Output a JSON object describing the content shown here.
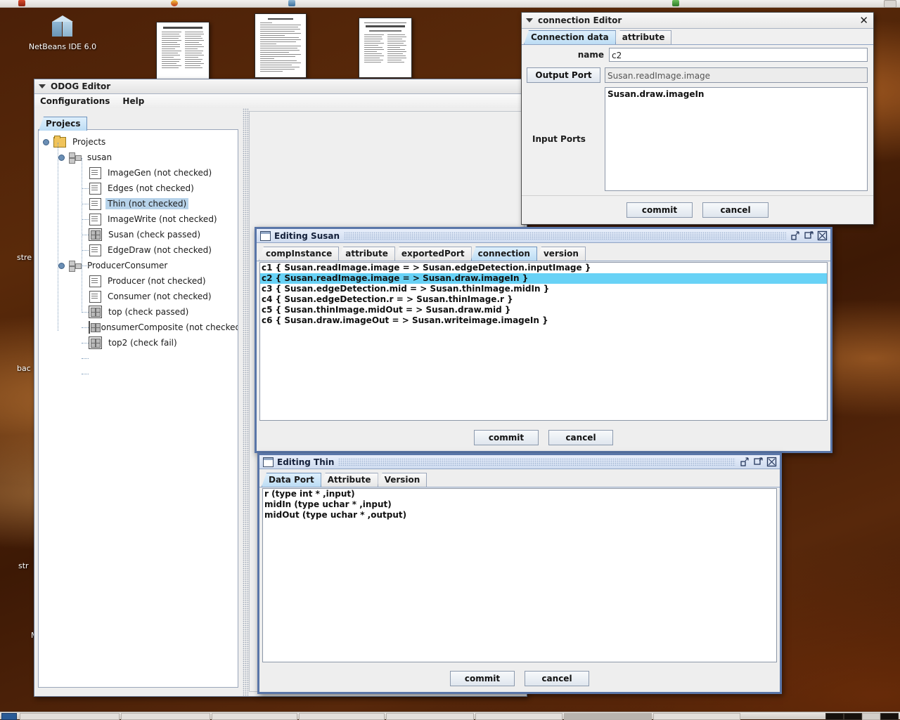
{
  "desktop": {
    "netbeans_icon_label": "NetBeans IDE 6.0",
    "clipped_labels": [
      "stre",
      "bac",
      "str",
      "M"
    ]
  },
  "odog_window": {
    "title": "ODOG Editor",
    "collapse_icon": "triangle-down-icon",
    "menus": [
      "Configurations",
      "Help"
    ],
    "tab_label": "Projecs",
    "tree": [
      {
        "label": "Projects",
        "icon": "folder-icon",
        "depth": 0,
        "handle": true
      },
      {
        "label": "susan",
        "icon": "composite-icon",
        "depth": 1,
        "handle": true
      },
      {
        "label": "ImageGen (not checked)",
        "icon": "component-icon",
        "depth": 2
      },
      {
        "label": "Edges (not checked)",
        "icon": "component-icon",
        "depth": 2
      },
      {
        "label": "Thin (not checked)",
        "icon": "component-icon",
        "depth": 2,
        "selected": true
      },
      {
        "label": "ImageWrite (not checked)",
        "icon": "component-icon",
        "depth": 2
      },
      {
        "label": "Susan (check passed)",
        "icon": "assembly-icon",
        "depth": 2
      },
      {
        "label": "EdgeDraw (not checked)",
        "icon": "component-icon",
        "depth": 2
      },
      {
        "label": "ProducerConsumer",
        "icon": "composite-icon",
        "depth": 1,
        "handle": true
      },
      {
        "label": "Producer (not checked)",
        "icon": "component-icon",
        "depth": 2
      },
      {
        "label": "Consumer (not checked)",
        "icon": "component-icon",
        "depth": 2
      },
      {
        "label": "top (check passed)",
        "icon": "assembly-icon",
        "depth": 2
      },
      {
        "label": "consumerComposite (not checked)",
        "icon": "assembly-icon",
        "depth": 2
      },
      {
        "label": "top2 (check fail)",
        "icon": "assembly-icon",
        "depth": 2
      }
    ]
  },
  "connection_editor": {
    "title": "connection Editor",
    "collapse_icon": "triangle-down-icon",
    "close_icon": "close-icon",
    "tabs": [
      {
        "label": "Connection data",
        "selected": true
      },
      {
        "label": "attribute",
        "selected": false
      }
    ],
    "name_label": "name",
    "name_value": "c2",
    "output_port_button": "Output Port",
    "output_port_value": "Susan.readImage.image",
    "input_ports_label": "Input Ports",
    "input_ports": [
      "Susan.draw.imageIn"
    ],
    "commit_label": "commit",
    "cancel_label": "cancel"
  },
  "editing_susan": {
    "title": "Editing Susan",
    "window_icon": "window-icon",
    "minimize_icon": "minimize-icon",
    "maximize_icon": "maximize-icon",
    "close_icon": "close-icon",
    "tabs": [
      {
        "label": "compInstance",
        "selected": false
      },
      {
        "label": "attribute",
        "selected": false
      },
      {
        "label": "exportedPort",
        "selected": false
      },
      {
        "label": "connection",
        "selected": true
      },
      {
        "label": "version",
        "selected": false
      }
    ],
    "connections": [
      {
        "text": "c1 { Susan.readImage.image = > Susan.edgeDetection.inputImage }",
        "selected": false
      },
      {
        "text": "c2 { Susan.readImage.image = > Susan.draw.imageIn }",
        "selected": true
      },
      {
        "text": "c3 { Susan.edgeDetection.mid = > Susan.thinImage.midIn }",
        "selected": false
      },
      {
        "text": "c4 { Susan.edgeDetection.r = > Susan.thinImage.r }",
        "selected": false
      },
      {
        "text": "c5 { Susan.thinImage.midOut = > Susan.draw.mid }",
        "selected": false
      },
      {
        "text": "c6 { Susan.draw.imageOut = > Susan.writeimage.imageIn }",
        "selected": false
      }
    ],
    "commit_label": "commit",
    "cancel_label": "cancel"
  },
  "editing_thin": {
    "title": "Editing Thin",
    "window_icon": "window-icon",
    "minimize_icon": "minimize-icon",
    "maximize_icon": "maximize-icon",
    "close_icon": "close-icon",
    "tabs": [
      {
        "label": "Data Port",
        "selected": true
      },
      {
        "label": "Attribute",
        "selected": false
      },
      {
        "label": "Version",
        "selected": false
      }
    ],
    "ports": [
      "r (type int * ,input)",
      "midIn (type uchar * ,input)",
      "midOut (type uchar * ,output)"
    ],
    "commit_label": "commit",
    "cancel_label": "cancel"
  },
  "colors": {
    "selection": "#68d2f6",
    "tree_selection": "#b7d3ea",
    "tab_selected": "#bcdcf4",
    "frame_border": "#5a76a8",
    "desktop": "#4b2008"
  }
}
